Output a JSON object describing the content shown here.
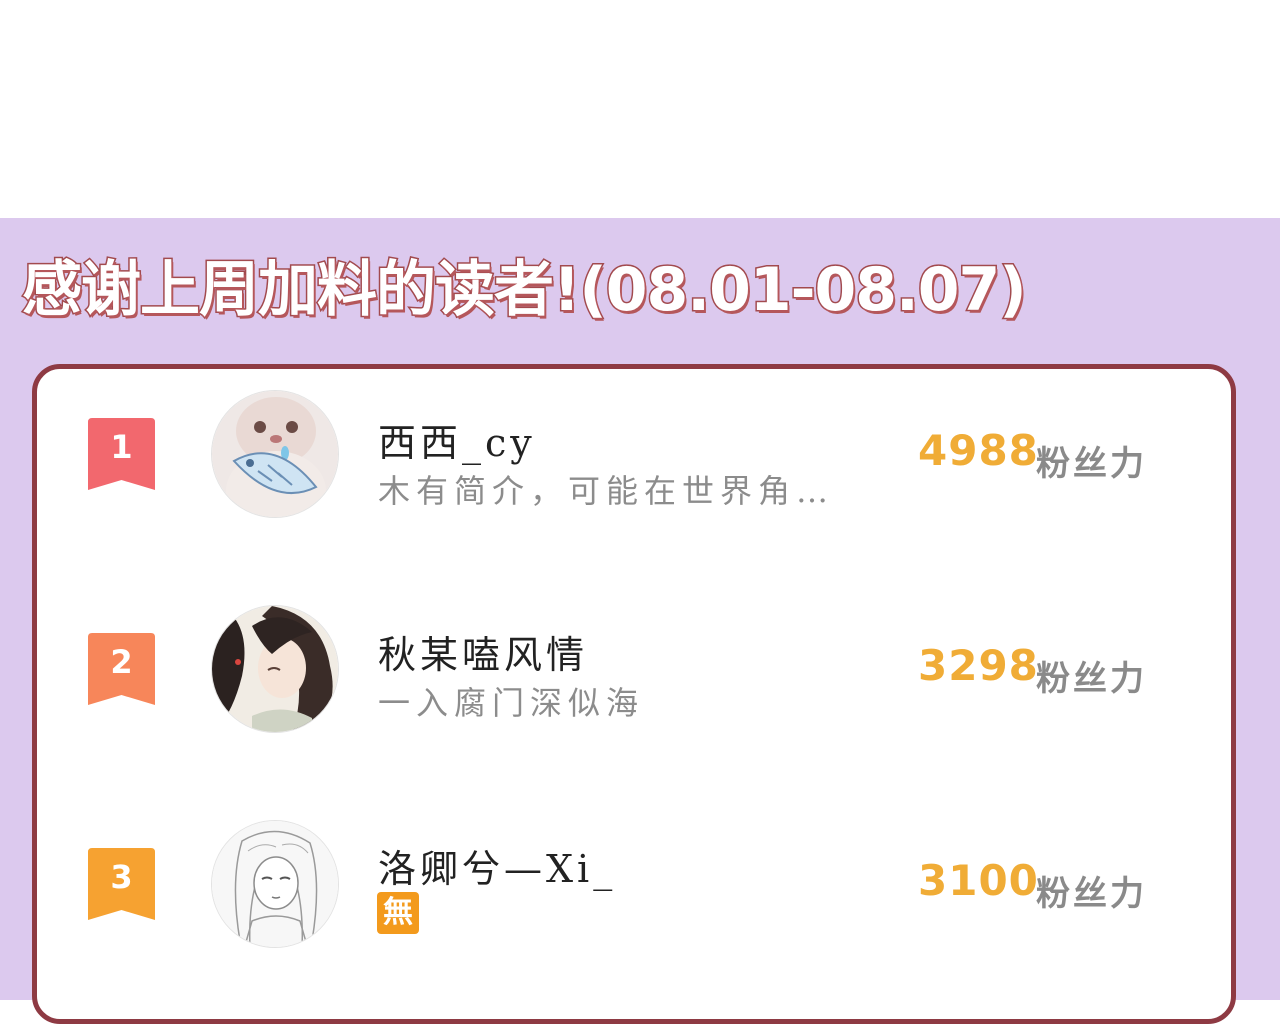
{
  "header": {
    "title": "感谢上周加料的读者!(08.01-08.07)"
  },
  "colors": {
    "panel_bg": "#dcc9ee",
    "card_border": "#8e3a43",
    "score": "#f0ac36",
    "rank1": "#f2686e",
    "rank2": "#f7865a",
    "rank3": "#f6a231"
  },
  "leaderboard": [
    {
      "rank": "1",
      "name": "西西_cy",
      "bio": "木有简介，可能在世界角…",
      "score": "4988",
      "unit": "粉丝力",
      "avatar_icon": "cat-holding-fish-avatar"
    },
    {
      "rank": "2",
      "name": "秋某嗑风情",
      "bio": "一入腐门深似海",
      "score": "3298",
      "unit": "粉丝力",
      "avatar_icon": "long-hair-character-avatar"
    },
    {
      "rank": "3",
      "name": "洛卿兮—Xi_",
      "badge": "無",
      "score": "3100",
      "unit": "粉丝力",
      "avatar_icon": "sketch-girl-avatar"
    }
  ]
}
